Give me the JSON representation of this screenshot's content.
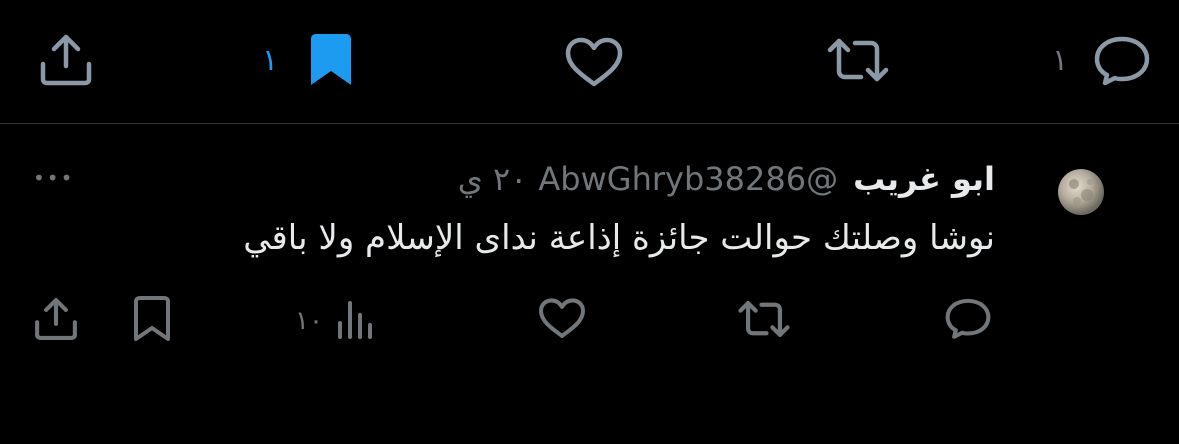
{
  "top_actions": {
    "reply_count": "١",
    "bookmark_count": "١",
    "bookmark_color": "#1d9bf0",
    "icon_color": "#8b98a5"
  },
  "reply": {
    "author_name": "ابو غريب",
    "handle": "@AbwGhryb38286",
    "time": "٢٠ ي",
    "text": "نوشا وصلتك حوالت جائزة إذاعة نداى الإسلام ولا باقي",
    "views_count": "١٠",
    "more_label": "•••"
  }
}
